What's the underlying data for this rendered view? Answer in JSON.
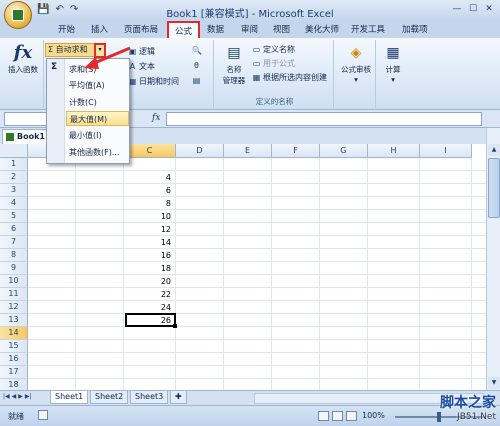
{
  "window": {
    "title": "Book1 [兼容模式] - Microsoft Excel"
  },
  "qat": [
    "💾",
    "↶",
    "↷"
  ],
  "tabs": [
    "开始",
    "插入",
    "页面布局",
    "公式",
    "数据",
    "审阅",
    "视图",
    "美化大师",
    "开发工具",
    "加载项"
  ],
  "ribbon": {
    "insert_function": "插入函数",
    "autosum": "自动求和",
    "logical": "逻辑",
    "text": "文本",
    "datetime": "日期和时间",
    "name_manager": "名称\n管理器",
    "define_name": "定义名称",
    "use_in_formula": "用于公式",
    "create_from_sel": "根据所选内容创建",
    "defined_names_group": "定义的名称",
    "formula_audit": "公式审核",
    "calculate": "计算"
  },
  "namebar": {
    "name": "",
    "fx": "fx",
    "formula": ""
  },
  "workbook_tab": "Book1",
  "columns": [
    "A",
    "B",
    "C",
    "D",
    "E",
    "F",
    "G",
    "H",
    "I"
  ],
  "selected_column": "C",
  "rows": [
    "1",
    "2",
    "3",
    "4",
    "5",
    "6",
    "7",
    "8",
    "9",
    "10",
    "11",
    "12",
    "13",
    "14",
    "15",
    "16",
    "17",
    "18"
  ],
  "selected_row": "14",
  "cells_c": [
    "",
    "4",
    "6",
    "8",
    "10",
    "12",
    "14",
    "16",
    "18",
    "20",
    "22",
    "24",
    "26",
    ""
  ],
  "dropdown": {
    "items": [
      "求和(S)",
      "平均值(A)",
      "计数(C)",
      "最大值(M)",
      "最小值(I)",
      "其他函数(F)..."
    ],
    "highlighted_index": 3
  },
  "sheets": [
    "Sheet1",
    "Sheet2",
    "Sheet3"
  ],
  "status": {
    "ready": "就绪",
    "zoom": "100%"
  },
  "watermark": {
    "line1": "脚本之家",
    "line2": "JB51.Net"
  }
}
